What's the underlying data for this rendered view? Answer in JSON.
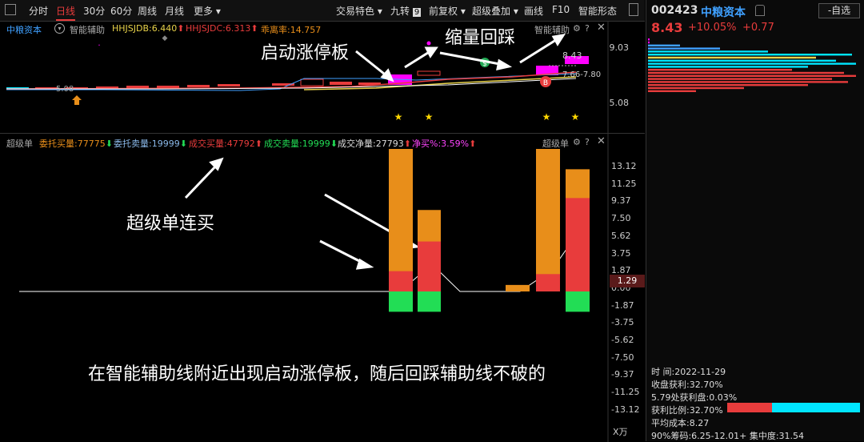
{
  "topbar": {
    "tabs": [
      "分时",
      "日线",
      "30分",
      "60分",
      "周线",
      "月线",
      "更多"
    ],
    "active_tab": "日线",
    "right_items": [
      "交易特色",
      "九转",
      "前复权",
      "超级叠加",
      "画线",
      "F10",
      "智能形态"
    ],
    "jiuzhuan_badge": "9"
  },
  "chart1": {
    "stock_name": "中粮资本",
    "indicator": "智能辅助",
    "hhjsjdb": "HHJSJDB:6.440",
    "hhjsjdc": "HHJSJDC:6.313",
    "ratio": "乖离率:14.757",
    "right_indicator": "智能辅助",
    "axis": [
      "9.03",
      "5.08"
    ],
    "price_box": "8.43",
    "range_label": "7.66-7.80",
    "low_label": "5.08",
    "buy_mark": "B",
    "sell_mark": "$",
    "annotation_start": "启动涨停板",
    "annotation_shrink": "缩量回踩"
  },
  "chart2": {
    "title": "超级单",
    "entrust_buy": "委托买量:77775",
    "entrust_sell": "委托卖量:19999",
    "deal_buy": "成交买量:47792",
    "deal_sell": "成交卖量:19999",
    "deal_net": "成交净量:27793",
    "net_buy_pct": "净买%:3.59%",
    "right_title": "超级单",
    "axis": [
      "13.12",
      "11.25",
      "9.37",
      "7.50",
      "5.62",
      "3.75",
      "1.87",
      "0.00",
      "-1.87",
      "-3.75",
      "-5.62",
      "-7.50",
      "-9.37",
      "-11.25",
      "-13.12"
    ],
    "unit": "X万",
    "current_value": "1.29",
    "annotation_super": "超级单连买",
    "annotation_bottom": "在智能辅助线附近出现启动涨停板，随后回踩辅助线不破的"
  },
  "chart_data": {
    "type": "bar",
    "series": [
      {
        "name": "委托买量",
        "values": [
          13.12,
          7.5,
          0.6,
          13.12,
          11.25
        ]
      },
      {
        "name": "成交买量",
        "values": [
          1.87,
          4.6,
          0,
          1.6,
          8.6
        ]
      },
      {
        "name": "成交卖量",
        "values": [
          -1.87,
          -1.87,
          0,
          0,
          -1.87
        ]
      }
    ],
    "ylim": [
      -13.12,
      13.12
    ]
  },
  "sidebar": {
    "code": "002423",
    "name": "中粮资本",
    "watch_button": "-自选",
    "price": "8.43",
    "change_pct": "+10.05%",
    "change": "+0.77",
    "time_label": "时  间:2022-11-29",
    "profit_close": "收盘获利:32.70%",
    "profit_579": "5.79处获利盘:0.03%",
    "profit_ratio": "获利比例:32.70%",
    "avg_cost": "平均成本:8.27",
    "chip_90": "90%筹码:6.25-12.01+ 集中度:31.54"
  },
  "colors": {
    "up": "#e83c3c",
    "down": "#22dd55",
    "orange": "#e88e1a",
    "magenta": "#ff00ff",
    "cyan": "#00e5ff"
  }
}
